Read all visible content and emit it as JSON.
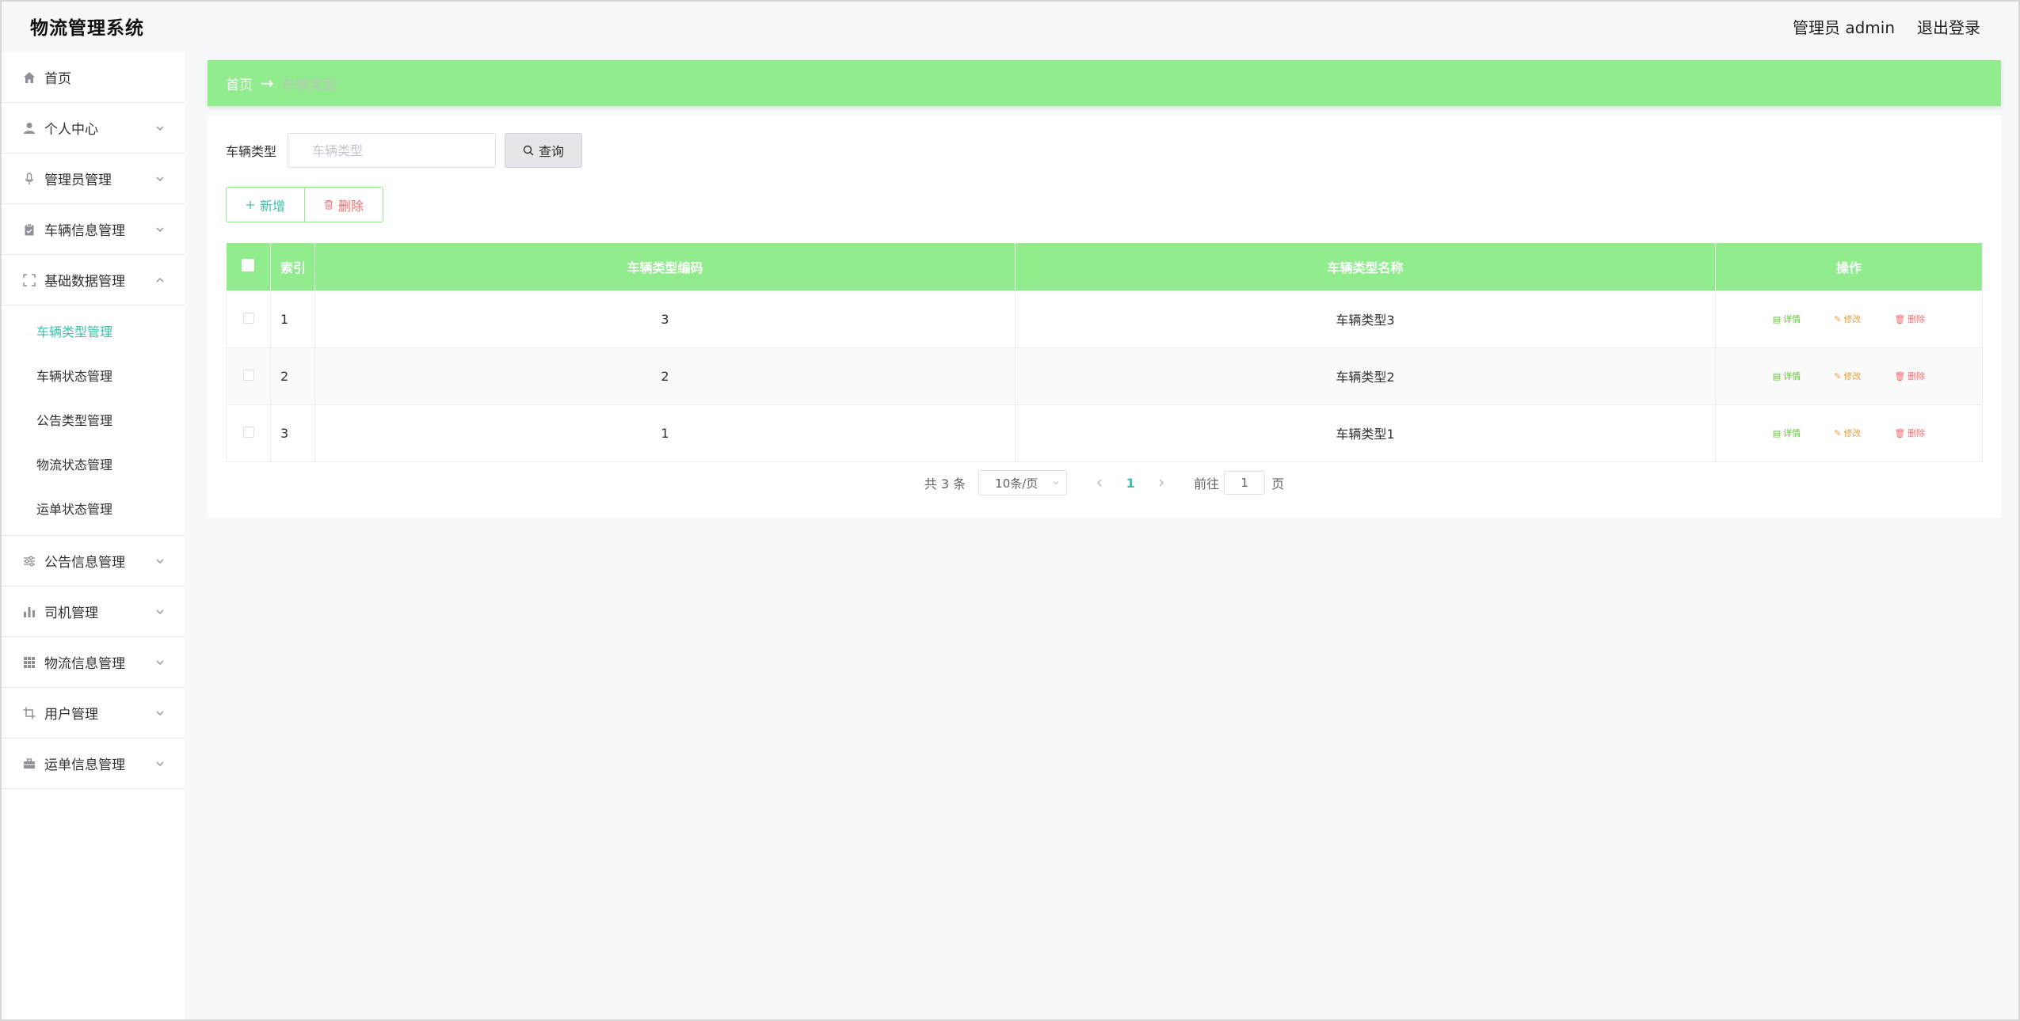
{
  "header": {
    "title": "物流管理系统",
    "user": "管理员 admin",
    "logout": "退出登录"
  },
  "sidebar": {
    "home": "首页",
    "items": [
      {
        "label": "个人中心",
        "icon": "user-icon"
      },
      {
        "label": "管理员管理",
        "icon": "mic-icon"
      },
      {
        "label": "车辆信息管理",
        "icon": "clipboard-icon"
      },
      {
        "label": "基础数据管理",
        "icon": "fullscreen-icon",
        "expanded": true
      },
      {
        "label": "公告信息管理",
        "icon": "sliders-icon"
      },
      {
        "label": "司机管理",
        "icon": "bar-chart-icon"
      },
      {
        "label": "物流信息管理",
        "icon": "grid-icon"
      },
      {
        "label": "用户管理",
        "icon": "crop-icon"
      },
      {
        "label": "运单信息管理",
        "icon": "briefcase-icon"
      }
    ],
    "sub_items": [
      "车辆类型管理",
      "车辆状态管理",
      "公告类型管理",
      "物流状态管理",
      "运单状态管理"
    ],
    "active_sub": "车辆类型管理"
  },
  "breadcrumb": {
    "home": "首页",
    "sep": "→",
    "current": "车辆类型"
  },
  "search": {
    "label": "车辆类型",
    "placeholder": "车辆类型",
    "button": "查询"
  },
  "actions": {
    "add": "新增",
    "delete": "删除"
  },
  "table": {
    "columns": [
      "索引",
      "车辆类型编码",
      "车辆类型名称",
      "操作"
    ],
    "rows": [
      {
        "index": "1",
        "code": "3",
        "name": "车辆类型3"
      },
      {
        "index": "2",
        "code": "2",
        "name": "车辆类型2"
      },
      {
        "index": "3",
        "code": "1",
        "name": "车辆类型1"
      }
    ],
    "ops": {
      "detail": "详情",
      "edit": "修改",
      "delete": "删除"
    }
  },
  "pagination": {
    "total": "共 3 条",
    "page_size": "10条/页",
    "current": "1",
    "goto": "前往",
    "goto_value": "1",
    "unit": "页"
  },
  "colors": {
    "accent_green": "#90ec8d",
    "active_teal": "#3dbfa8",
    "danger": "#f56c6c",
    "warning": "#e6a23c",
    "success": "#67c23a"
  }
}
